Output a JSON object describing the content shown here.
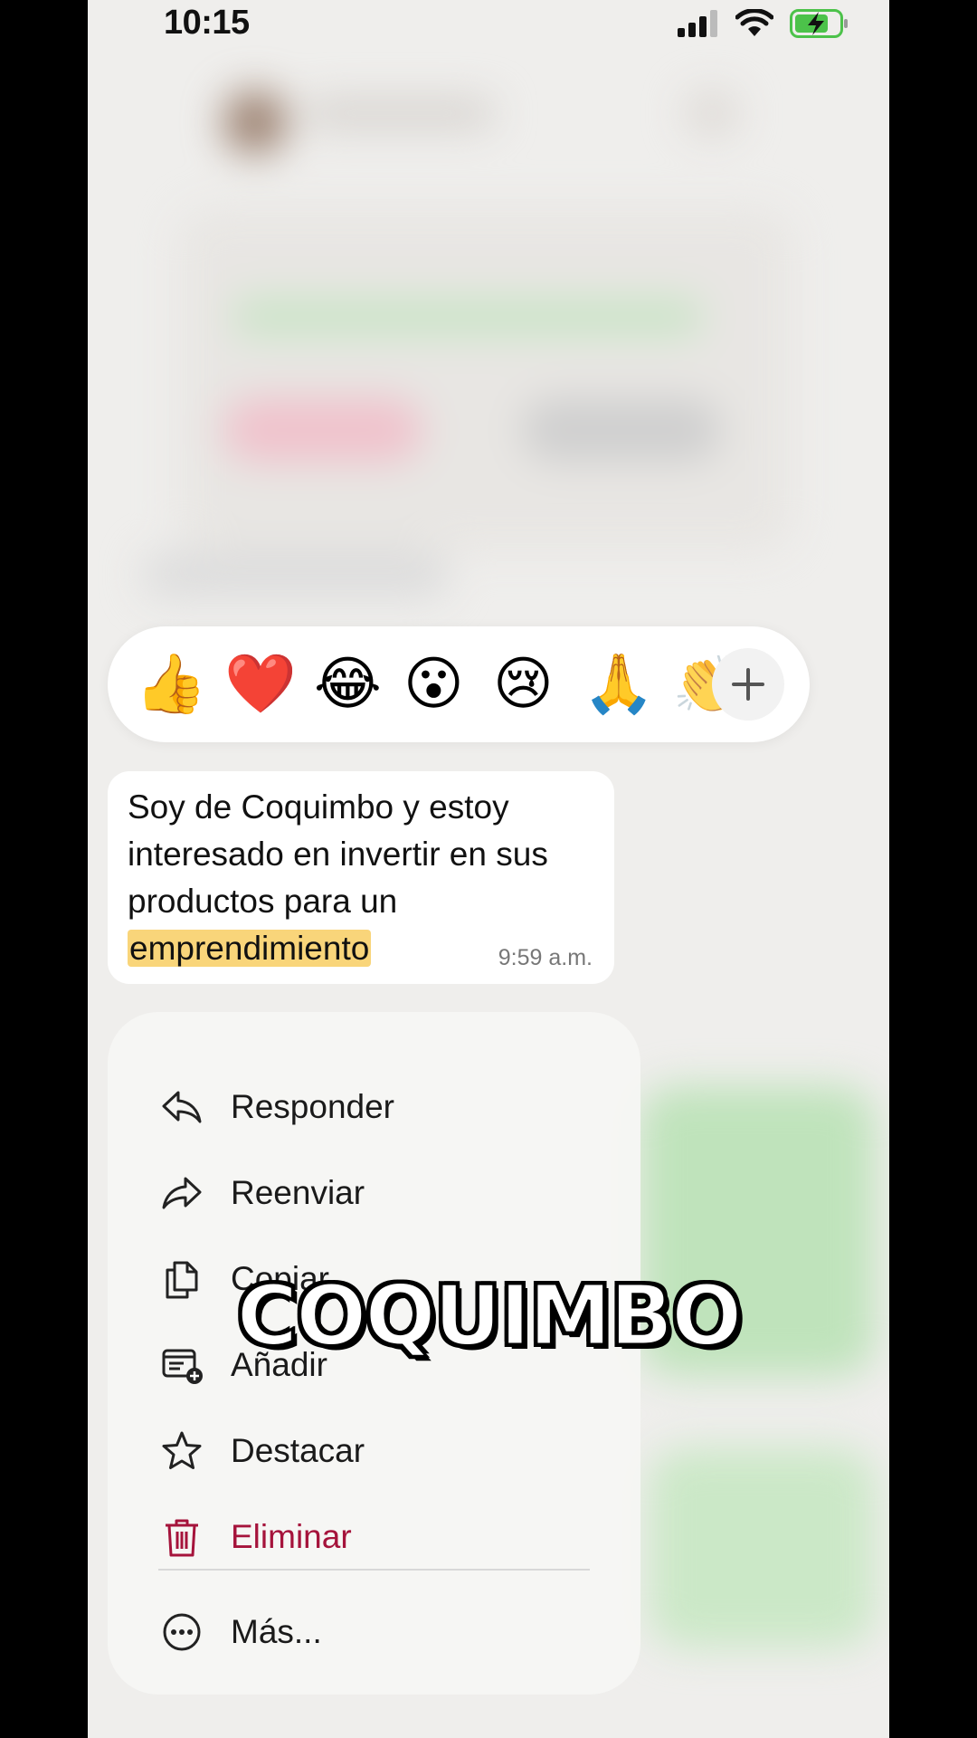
{
  "status_bar": {
    "time": "10:15"
  },
  "reactions": {
    "emojis": [
      {
        "name": "thumbs-up",
        "glyph": "👍"
      },
      {
        "name": "red-heart",
        "glyph": "❤️"
      },
      {
        "name": "tears-of-joy",
        "glyph": "😂"
      },
      {
        "name": "surprised",
        "glyph": "😮"
      },
      {
        "name": "crying",
        "glyph": "😢"
      },
      {
        "name": "folded-hands",
        "glyph": "🙏"
      },
      {
        "name": "clapping-hands",
        "glyph": "👏"
      }
    ],
    "more_icon": "plus-icon"
  },
  "message": {
    "text_before": "Soy de Coquimbo y estoy interesado en invertir en sus productos para un ",
    "highlight": "emprendimiento",
    "time": "9:59 a.m.",
    "highlight_color": "#f9d57a"
  },
  "menu": {
    "responder": "Responder",
    "reenviar": "Reenviar",
    "copiar": "Copiar",
    "anadir": "Añadir",
    "destacar": "Destacar",
    "eliminar": "Eliminar",
    "mas": "Más...",
    "danger_color": "#a5133b"
  },
  "overlay_caption": "COQUIMBO"
}
